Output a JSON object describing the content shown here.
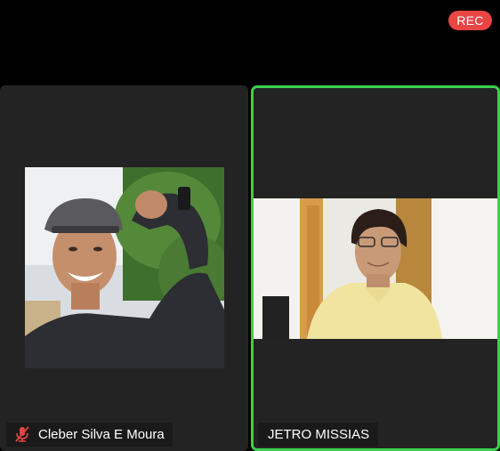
{
  "recording": {
    "label": "REC",
    "color": "#e94545"
  },
  "accent": {
    "active_speaker_border": "#3ccf4e"
  },
  "participants": [
    {
      "name": "Cleber Silva E Moura",
      "muted": true,
      "mic_icon": "muted-mic-icon",
      "active_speaker": false
    },
    {
      "name": "JETRO MISSIAS",
      "muted": false,
      "active_speaker": true
    }
  ]
}
